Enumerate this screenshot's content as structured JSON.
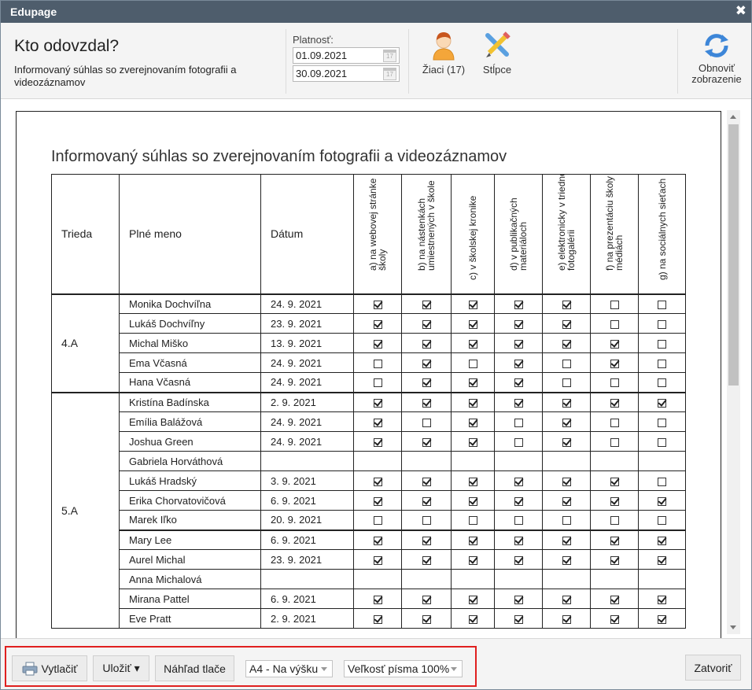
{
  "window": {
    "title": "Edupage",
    "close_glyph": "✖"
  },
  "header": {
    "title": "Kto odovzdal?",
    "subtitle": "Informovaný súhlas so zverejnovaním fotografii a videozáznamov",
    "validity_label": "Platnosť:",
    "date_from": "01.09.2021",
    "date_to": "30.09.2021",
    "students_label": "Žiaci (17)",
    "columns_label": "Stĺpce",
    "refresh_label_1": "Obnoviť",
    "refresh_label_2": "zobrazenie"
  },
  "document": {
    "title": "Informovaný súhlas so zverejnovaním fotografii a videozáznamov",
    "columns": {
      "class": "Trieda",
      "name": "Plné meno",
      "date": "Dátum",
      "consents": [
        "a) na webovej stránke školy",
        "b) na nástenkách umiestnených v škole",
        "c) v školskej kronike",
        "d) v publikačných materiáloch",
        "e) elektronicky v triednej fotogalérii",
        "f) na prezentáciu školy v médiách",
        "g) na sociálnych sieťach"
      ]
    },
    "groups": [
      {
        "class": "4.A",
        "rows": [
          {
            "name": "Monika Dochvíľna",
            "date": "24. 9. 2021",
            "checks": [
              1,
              1,
              1,
              1,
              1,
              0,
              0
            ]
          },
          {
            "name": "Lukáš Dochvíľny",
            "date": "23. 9. 2021",
            "checks": [
              1,
              1,
              1,
              1,
              1,
              0,
              0
            ]
          },
          {
            "name": "Michal Miško",
            "date": "13. 9. 2021",
            "checks": [
              1,
              1,
              1,
              1,
              1,
              1,
              0
            ]
          },
          {
            "name": "Ema Včasná",
            "date": "24. 9. 2021",
            "checks": [
              0,
              1,
              0,
              1,
              0,
              1,
              0
            ]
          },
          {
            "name": "Hana Včasná",
            "date": "24. 9. 2021",
            "checks": [
              0,
              1,
              1,
              1,
              0,
              0,
              0
            ]
          }
        ]
      },
      {
        "class": "5.A",
        "rows": [
          {
            "name": "Kristína Badínska",
            "date": "2. 9. 2021",
            "checks": [
              1,
              1,
              1,
              1,
              1,
              1,
              1
            ]
          },
          {
            "name": "Emília Balážová",
            "date": "24. 9. 2021",
            "checks": [
              1,
              0,
              1,
              0,
              1,
              0,
              0
            ]
          },
          {
            "name": "Joshua Green",
            "date": "24. 9. 2021",
            "checks": [
              1,
              1,
              1,
              0,
              1,
              0,
              0
            ]
          },
          {
            "name": "Gabriela Horváthová",
            "date": "",
            "checks": null
          },
          {
            "name": "Lukáš Hradský",
            "date": "3. 9. 2021",
            "checks": [
              1,
              1,
              1,
              1,
              1,
              1,
              0
            ]
          },
          {
            "name": "Erika Chorvatovičová",
            "date": "6. 9. 2021",
            "checks": [
              1,
              1,
              1,
              1,
              1,
              1,
              1
            ]
          },
          {
            "name": "Marek Iľko",
            "date": "20. 9. 2021",
            "checks": [
              0,
              0,
              0,
              0,
              0,
              0,
              0
            ]
          },
          {
            "name": "Mary Lee",
            "date": "6. 9. 2021",
            "checks": [
              1,
              1,
              1,
              1,
              1,
              1,
              1
            ],
            "separator": true
          },
          {
            "name": "Aurel Michal",
            "date": "23. 9. 2021",
            "checks": [
              1,
              1,
              1,
              1,
              1,
              1,
              1
            ]
          },
          {
            "name": "Anna Michalová",
            "date": "",
            "checks": null
          },
          {
            "name": "Mirana Pattel",
            "date": "6. 9. 2021",
            "checks": [
              1,
              1,
              1,
              1,
              1,
              1,
              1
            ]
          },
          {
            "name": "Eve Pratt",
            "date": "2. 9. 2021",
            "checks": [
              1,
              1,
              1,
              1,
              1,
              1,
              1
            ]
          }
        ]
      }
    ]
  },
  "footer": {
    "print_label": "Vytlačiť",
    "save_label": "Uložiť ▾",
    "preview_label": "Náhľad tlače",
    "page_format": "A4 - Na výšku",
    "font_size": "Veľkosť písma 100%",
    "close_label": "Zatvoriť"
  },
  "colors": {
    "titlebar": "#4e5d6c",
    "highlight": "#e0201f",
    "refresh_icon": "#3d86d8"
  },
  "icons": [
    "close-icon",
    "calendar-icon",
    "student-icon",
    "columns-icon",
    "refresh-icon",
    "printer-icon"
  ]
}
